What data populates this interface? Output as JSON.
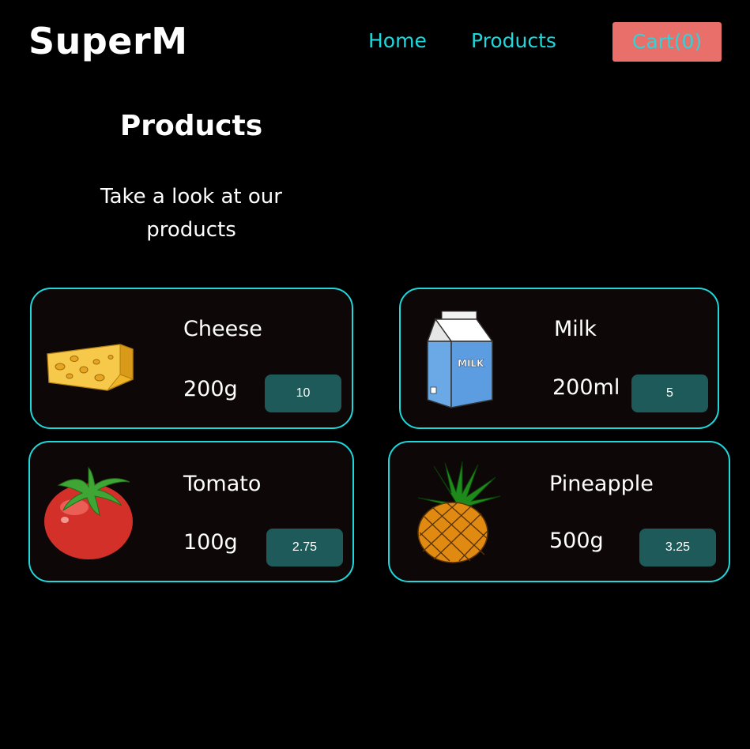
{
  "header": {
    "logo": "SuperM",
    "nav": [
      {
        "label": "Home"
      },
      {
        "label": "Products"
      }
    ],
    "cart_label": "Cart(0)"
  },
  "main": {
    "title": "Products",
    "subtitle": "Take a look at our products"
  },
  "products": [
    {
      "name": "Cheese",
      "quantity": "200g",
      "price": "10",
      "icon": "cheese-icon"
    },
    {
      "name": "Milk",
      "quantity": "200ml",
      "price": "5",
      "icon": "milk-carton-icon"
    },
    {
      "name": "Tomato",
      "quantity": "100g",
      "price": "2.75",
      "icon": "tomato-icon"
    },
    {
      "name": "Pineapple",
      "quantity": "500g",
      "price": "3.25",
      "icon": "pineapple-icon"
    }
  ],
  "colors": {
    "background": "#000000",
    "accent": "#1fd8dc",
    "cart_button": "#e86f6a",
    "price_button": "#1e5a59",
    "card_background": "#0d0707"
  }
}
